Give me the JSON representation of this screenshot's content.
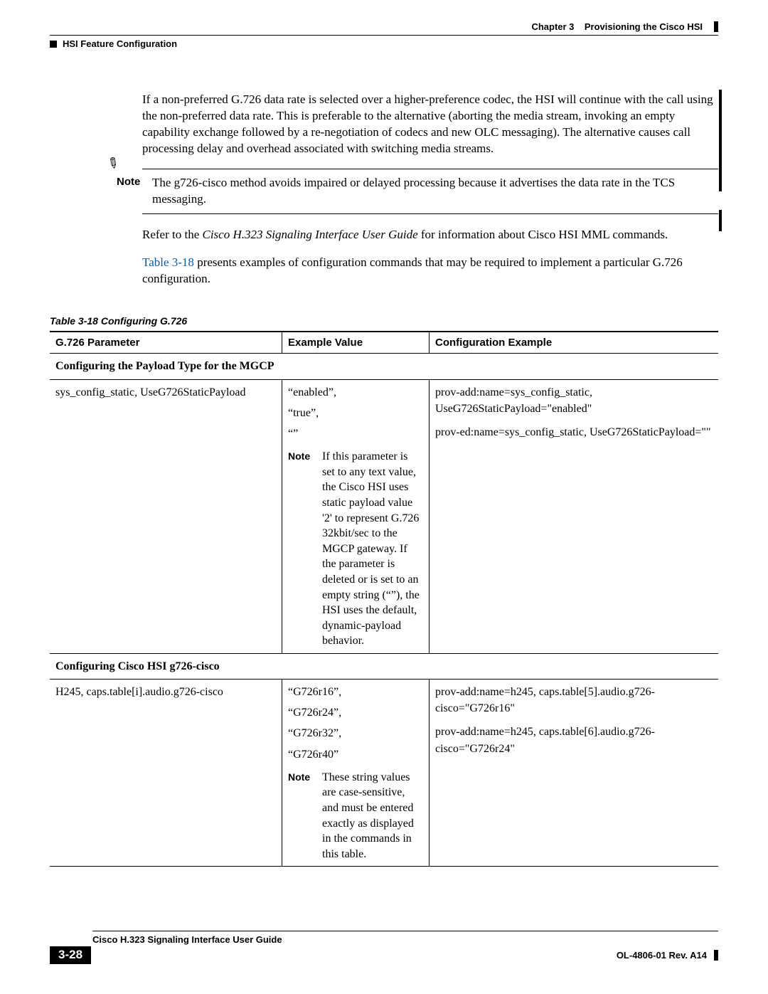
{
  "header": {
    "chapter_label": "Chapter 3",
    "chapter_title": "Provisioning the Cisco HSI",
    "section": "HSI Feature Configuration"
  },
  "paragraphs": {
    "intro": "If a non-preferred G.726 data rate is selected over a higher-preference codec, the HSI will continue with the call using the non-preferred data rate. This is preferable to the alternative (aborting the media stream, invoking an empty capability exchange followed by a re-negotiation of codecs and new OLC messaging). The alternative causes call processing delay and overhead associated with switching media streams.",
    "note_label": "Note",
    "note_text": "The g726-cisco method avoids impaired or delayed processing because it advertises the data rate in the TCS messaging.",
    "refer_pre": "Refer to the ",
    "refer_italic": "Cisco H.323 Signaling Interface User Guide",
    "refer_post": " for information about Cisco HSI MML commands.",
    "tablelink": "Table 3-18",
    "tablelink_post": " presents examples of configuration commands that may be required to implement a particular G.726 configuration."
  },
  "table": {
    "caption": "Table 3-18    Configuring G.726",
    "headers": {
      "c1": "G.726 Parameter",
      "c2": "Example Value",
      "c3": "Configuration Example"
    },
    "section1": "Configuring the Payload Type for the MGCP",
    "row1": {
      "param": "sys_config_static, UseG726StaticPayload",
      "vals": {
        "v1": "“enabled”,",
        "v2": "“true”,",
        "v3": "“”"
      },
      "note_label": "Note",
      "note": "If this parameter is set to any text value, the Cisco HSI uses static payload value '2' to represent G.726 32kbit/sec to the MGCP gateway. If the parameter is deleted or is set to an empty string (“”), the HSI uses the default, dynamic-payload behavior.",
      "cfg1": "prov-add:name=sys_config_static, UseG726StaticPayload=\"enabled\"",
      "cfg2": "prov-ed:name=sys_config_static, UseG726StaticPayload=\"\""
    },
    "section2": "Configuring Cisco HSI g726-cisco",
    "row2": {
      "param": "H245, caps.table[i].audio.g726-cisco",
      "vals": {
        "v1": "“G726r16”,",
        "v2": "“G726r24”,",
        "v3": "“G726r32”,",
        "v4": "“G726r40”"
      },
      "note_label": "Note",
      "note": "These string values are case-sensitive, and must be entered exactly as displayed in the commands in this table.",
      "cfg1": "prov-add:name=h245, caps.table[5].audio.g726-cisco=\"G726r16\"",
      "cfg2": "prov-add:name=h245, caps.table[6].audio.g726-cisco=\"G726r24\""
    }
  },
  "footer": {
    "book": "Cisco H.323 Signaling Interface User Guide",
    "page": "3-28",
    "rev": "OL-4806-01 Rev. A14"
  }
}
